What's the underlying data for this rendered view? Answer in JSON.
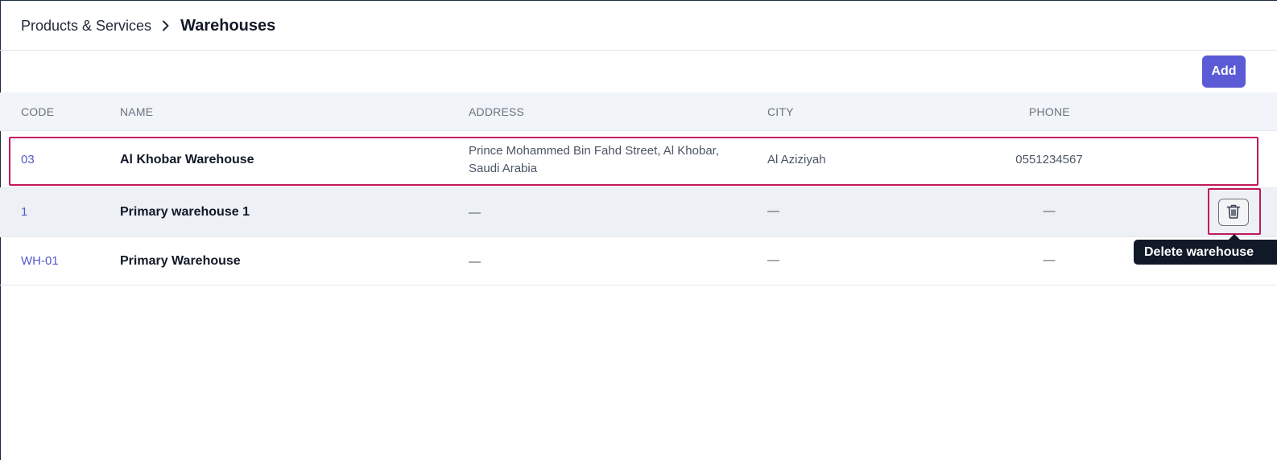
{
  "breadcrumb": {
    "parent": "Products & Services",
    "separator_icon": "chevron-right-icon",
    "current": "Warehouses"
  },
  "toolbar": {
    "add_label": "Add"
  },
  "table": {
    "columns": [
      "CODE",
      "NAME",
      "ADDRESS",
      "CITY",
      "PHONE"
    ],
    "rows": [
      {
        "code": "03",
        "name": "Al Khobar Warehouse",
        "address_line1": "Prince Mohammed Bin Fahd Street, Al Khobar,",
        "address_line2": "Saudi Arabia",
        "city": "Al Aziziyah",
        "phone": "0551234567"
      },
      {
        "code": "1",
        "name": "Primary warehouse 1",
        "address_line1": "—",
        "address_line2": "",
        "city": "—",
        "phone": "—"
      },
      {
        "code": "WH-01",
        "name": "Primary Warehouse",
        "address_line1": "—",
        "address_line2": "",
        "city": "—",
        "phone": "—"
      }
    ]
  },
  "delete_action": {
    "icon": "trash-icon",
    "tooltip": "Delete warehouse"
  },
  "colors": {
    "accent": "#5b5bd6",
    "code_link": "#5458c9",
    "highlight": "#c2185b",
    "tooltip_bg": "#111827"
  }
}
